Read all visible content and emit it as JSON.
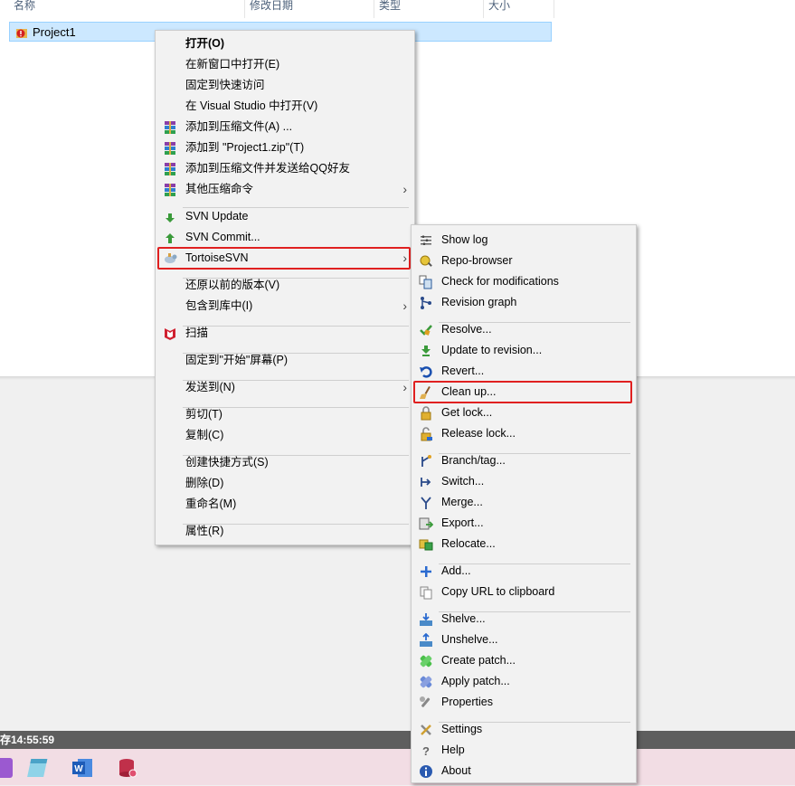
{
  "explorer": {
    "columns": [
      "名称",
      "修改日期",
      "类型",
      "大小"
    ],
    "file": {
      "name": "Project1"
    }
  },
  "context_menu": {
    "items": [
      {
        "label": "打开(O)",
        "icon": "none"
      },
      {
        "label": "在新窗口中打开(E)",
        "icon": "none"
      },
      {
        "label": "固定到快速访问",
        "icon": "none"
      },
      {
        "label": "在 Visual Studio 中打开(V)",
        "icon": "none"
      },
      {
        "label": "添加到压缩文件(A) ...",
        "icon": "winrar-icon"
      },
      {
        "label": "添加到 \"Project1.zip\"(T)",
        "icon": "winrar-icon"
      },
      {
        "label": "添加到压缩文件并发送给QQ好友",
        "icon": "winrar-icon"
      },
      {
        "label": "其他压缩命令",
        "icon": "winrar-icon"
      },
      {
        "label": "SVN Update",
        "icon": "svn-update-icon"
      },
      {
        "label": "SVN Commit...",
        "icon": "svn-commit-icon"
      },
      {
        "label": "TortoiseSVN",
        "icon": "tortoisesvn-icon"
      },
      {
        "label": "还原以前的版本(V)",
        "icon": "none"
      },
      {
        "label": "包含到库中(I)",
        "icon": "none"
      },
      {
        "label": "扫描",
        "icon": "mcafee-icon"
      },
      {
        "label": "固定到\"开始\"屏幕(P)",
        "icon": "none"
      },
      {
        "label": "发送到(N)",
        "icon": "none"
      },
      {
        "label": "剪切(T)",
        "icon": "none"
      },
      {
        "label": "复制(C)",
        "icon": "none"
      },
      {
        "label": "创建快捷方式(S)",
        "icon": "none"
      },
      {
        "label": "删除(D)",
        "icon": "none"
      },
      {
        "label": "重命名(M)",
        "icon": "none"
      },
      {
        "label": "属性(R)",
        "icon": "none"
      }
    ]
  },
  "svn_submenu": {
    "items": [
      {
        "label": "Show log",
        "icon": "log-icon"
      },
      {
        "label": "Repo-browser",
        "icon": "repo-browser-icon"
      },
      {
        "label": "Check for modifications",
        "icon": "check-modifications-icon"
      },
      {
        "label": "Revision graph",
        "icon": "revision-graph-icon"
      },
      {
        "label": "Resolve...",
        "icon": "resolve-icon"
      },
      {
        "label": "Update to revision...",
        "icon": "update-revision-icon"
      },
      {
        "label": "Revert...",
        "icon": "revert-icon"
      },
      {
        "label": "Clean up...",
        "icon": "cleanup-broom-icon"
      },
      {
        "label": "Get lock...",
        "icon": "lock-icon"
      },
      {
        "label": "Release lock...",
        "icon": "unlock-icon"
      },
      {
        "label": "Branch/tag...",
        "icon": "branch-icon"
      },
      {
        "label": "Switch...",
        "icon": "switch-icon"
      },
      {
        "label": "Merge...",
        "icon": "merge-icon"
      },
      {
        "label": "Export...",
        "icon": "export-icon"
      },
      {
        "label": "Relocate...",
        "icon": "relocate-icon"
      },
      {
        "label": "Add...",
        "icon": "add-icon"
      },
      {
        "label": "Copy URL to clipboard",
        "icon": "copy-url-icon"
      },
      {
        "label": "Shelve...",
        "icon": "shelve-icon"
      },
      {
        "label": "Unshelve...",
        "icon": "unshelve-icon"
      },
      {
        "label": "Create patch...",
        "icon": "create-patch-icon"
      },
      {
        "label": "Apply patch...",
        "icon": "apply-patch-icon"
      },
      {
        "label": "Properties",
        "icon": "properties-wrench-icon"
      },
      {
        "label": "Settings",
        "icon": "settings-icon"
      },
      {
        "label": "Help",
        "icon": "help-icon"
      },
      {
        "label": "About",
        "icon": "about-icon"
      }
    ]
  },
  "statusbar": {
    "text": "存14:55:59"
  },
  "taskbar": {
    "icons": [
      "onenote-icon",
      "notepad-icon",
      "word-icon",
      "database-icon"
    ]
  },
  "colors": {
    "highlight_border": "#e02020",
    "selection": "#cce8ff"
  }
}
